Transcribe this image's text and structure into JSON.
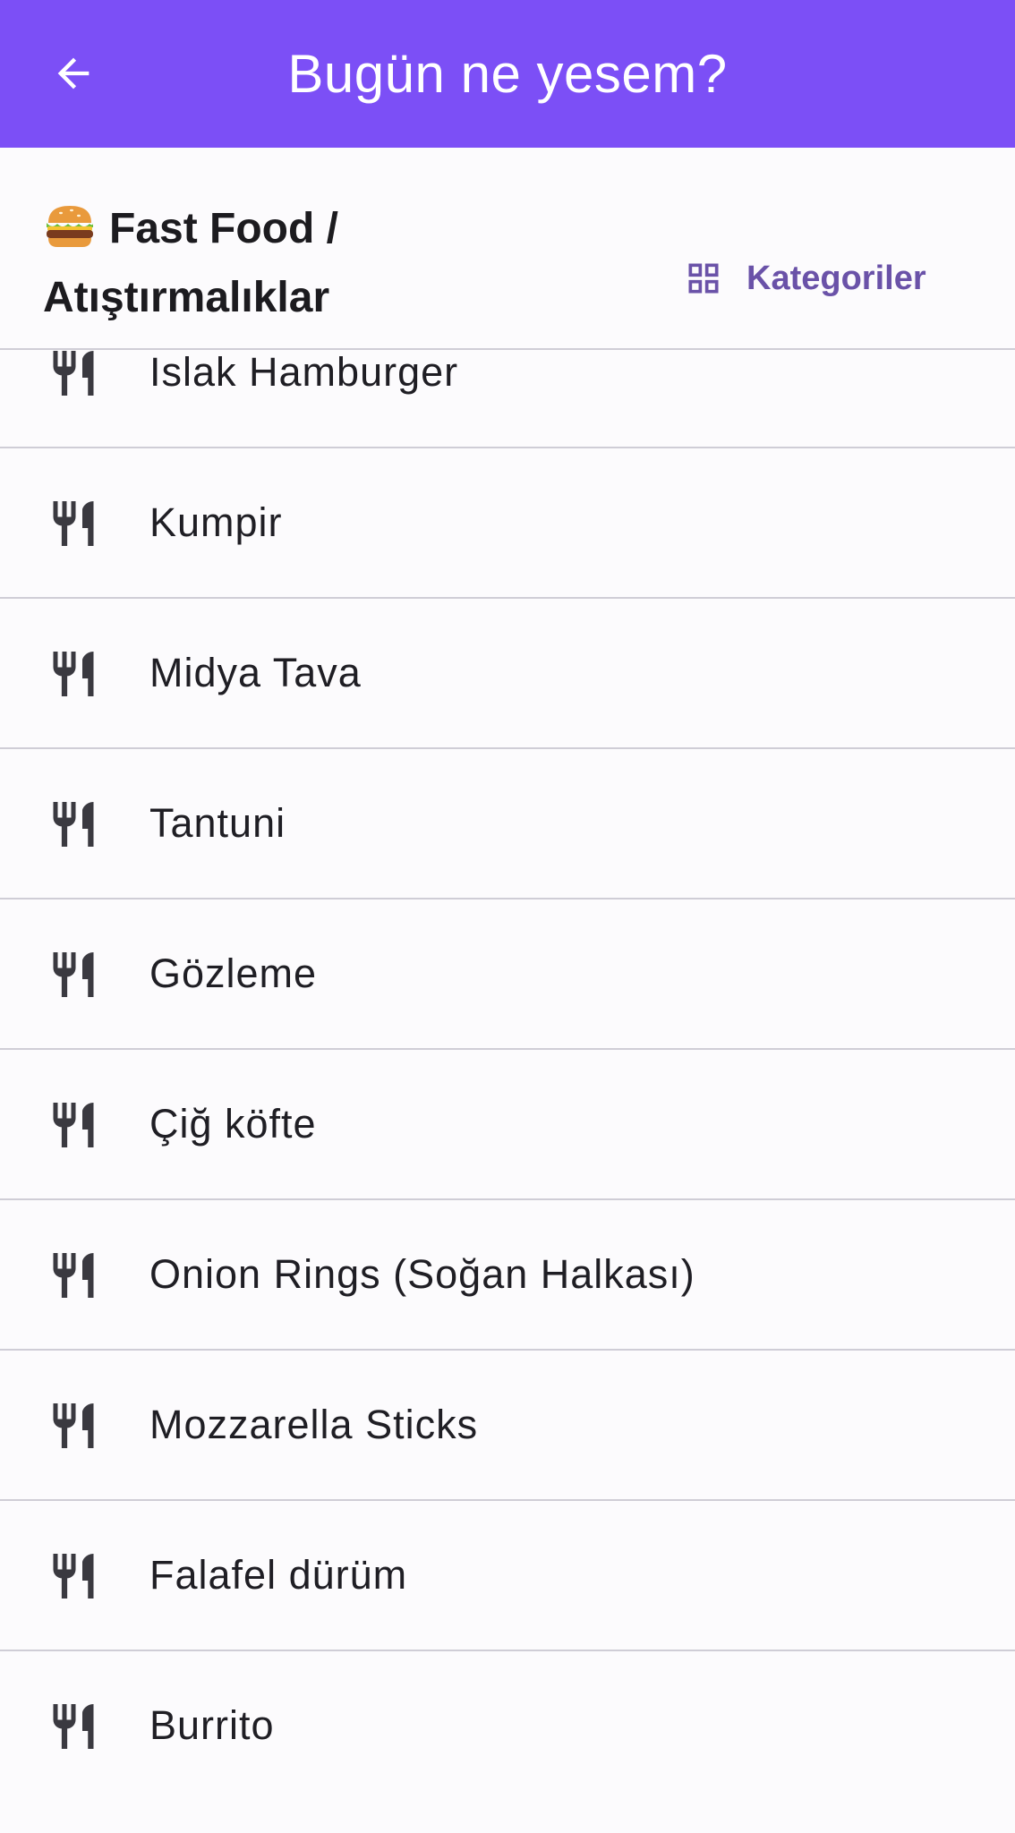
{
  "appbar": {
    "title": "Bugün ne yesem?",
    "back_icon": "arrow-back-icon",
    "color": "#7c4ff6"
  },
  "category": {
    "emoji": "🍔",
    "title": "Fast Food / Atıştırmalıklar",
    "button_label": "Kategoriler",
    "button_icon": "grid-icon",
    "accent": "#6a52a8"
  },
  "items": [
    {
      "label": "Islak Hamburger",
      "icon": "restaurant-icon"
    },
    {
      "label": "Kumpir",
      "icon": "restaurant-icon"
    },
    {
      "label": "Midya Tava",
      "icon": "restaurant-icon"
    },
    {
      "label": "Tantuni",
      "icon": "restaurant-icon"
    },
    {
      "label": "Gözleme",
      "icon": "restaurant-icon"
    },
    {
      "label": "Çiğ köfte",
      "icon": "restaurant-icon"
    },
    {
      "label": "Onion Rings (Soğan Halkası)",
      "icon": "restaurant-icon"
    },
    {
      "label": "Mozzarella Sticks",
      "icon": "restaurant-icon"
    },
    {
      "label": "Falafel dürüm",
      "icon": "restaurant-icon"
    },
    {
      "label": "Burrito",
      "icon": "restaurant-icon"
    }
  ]
}
